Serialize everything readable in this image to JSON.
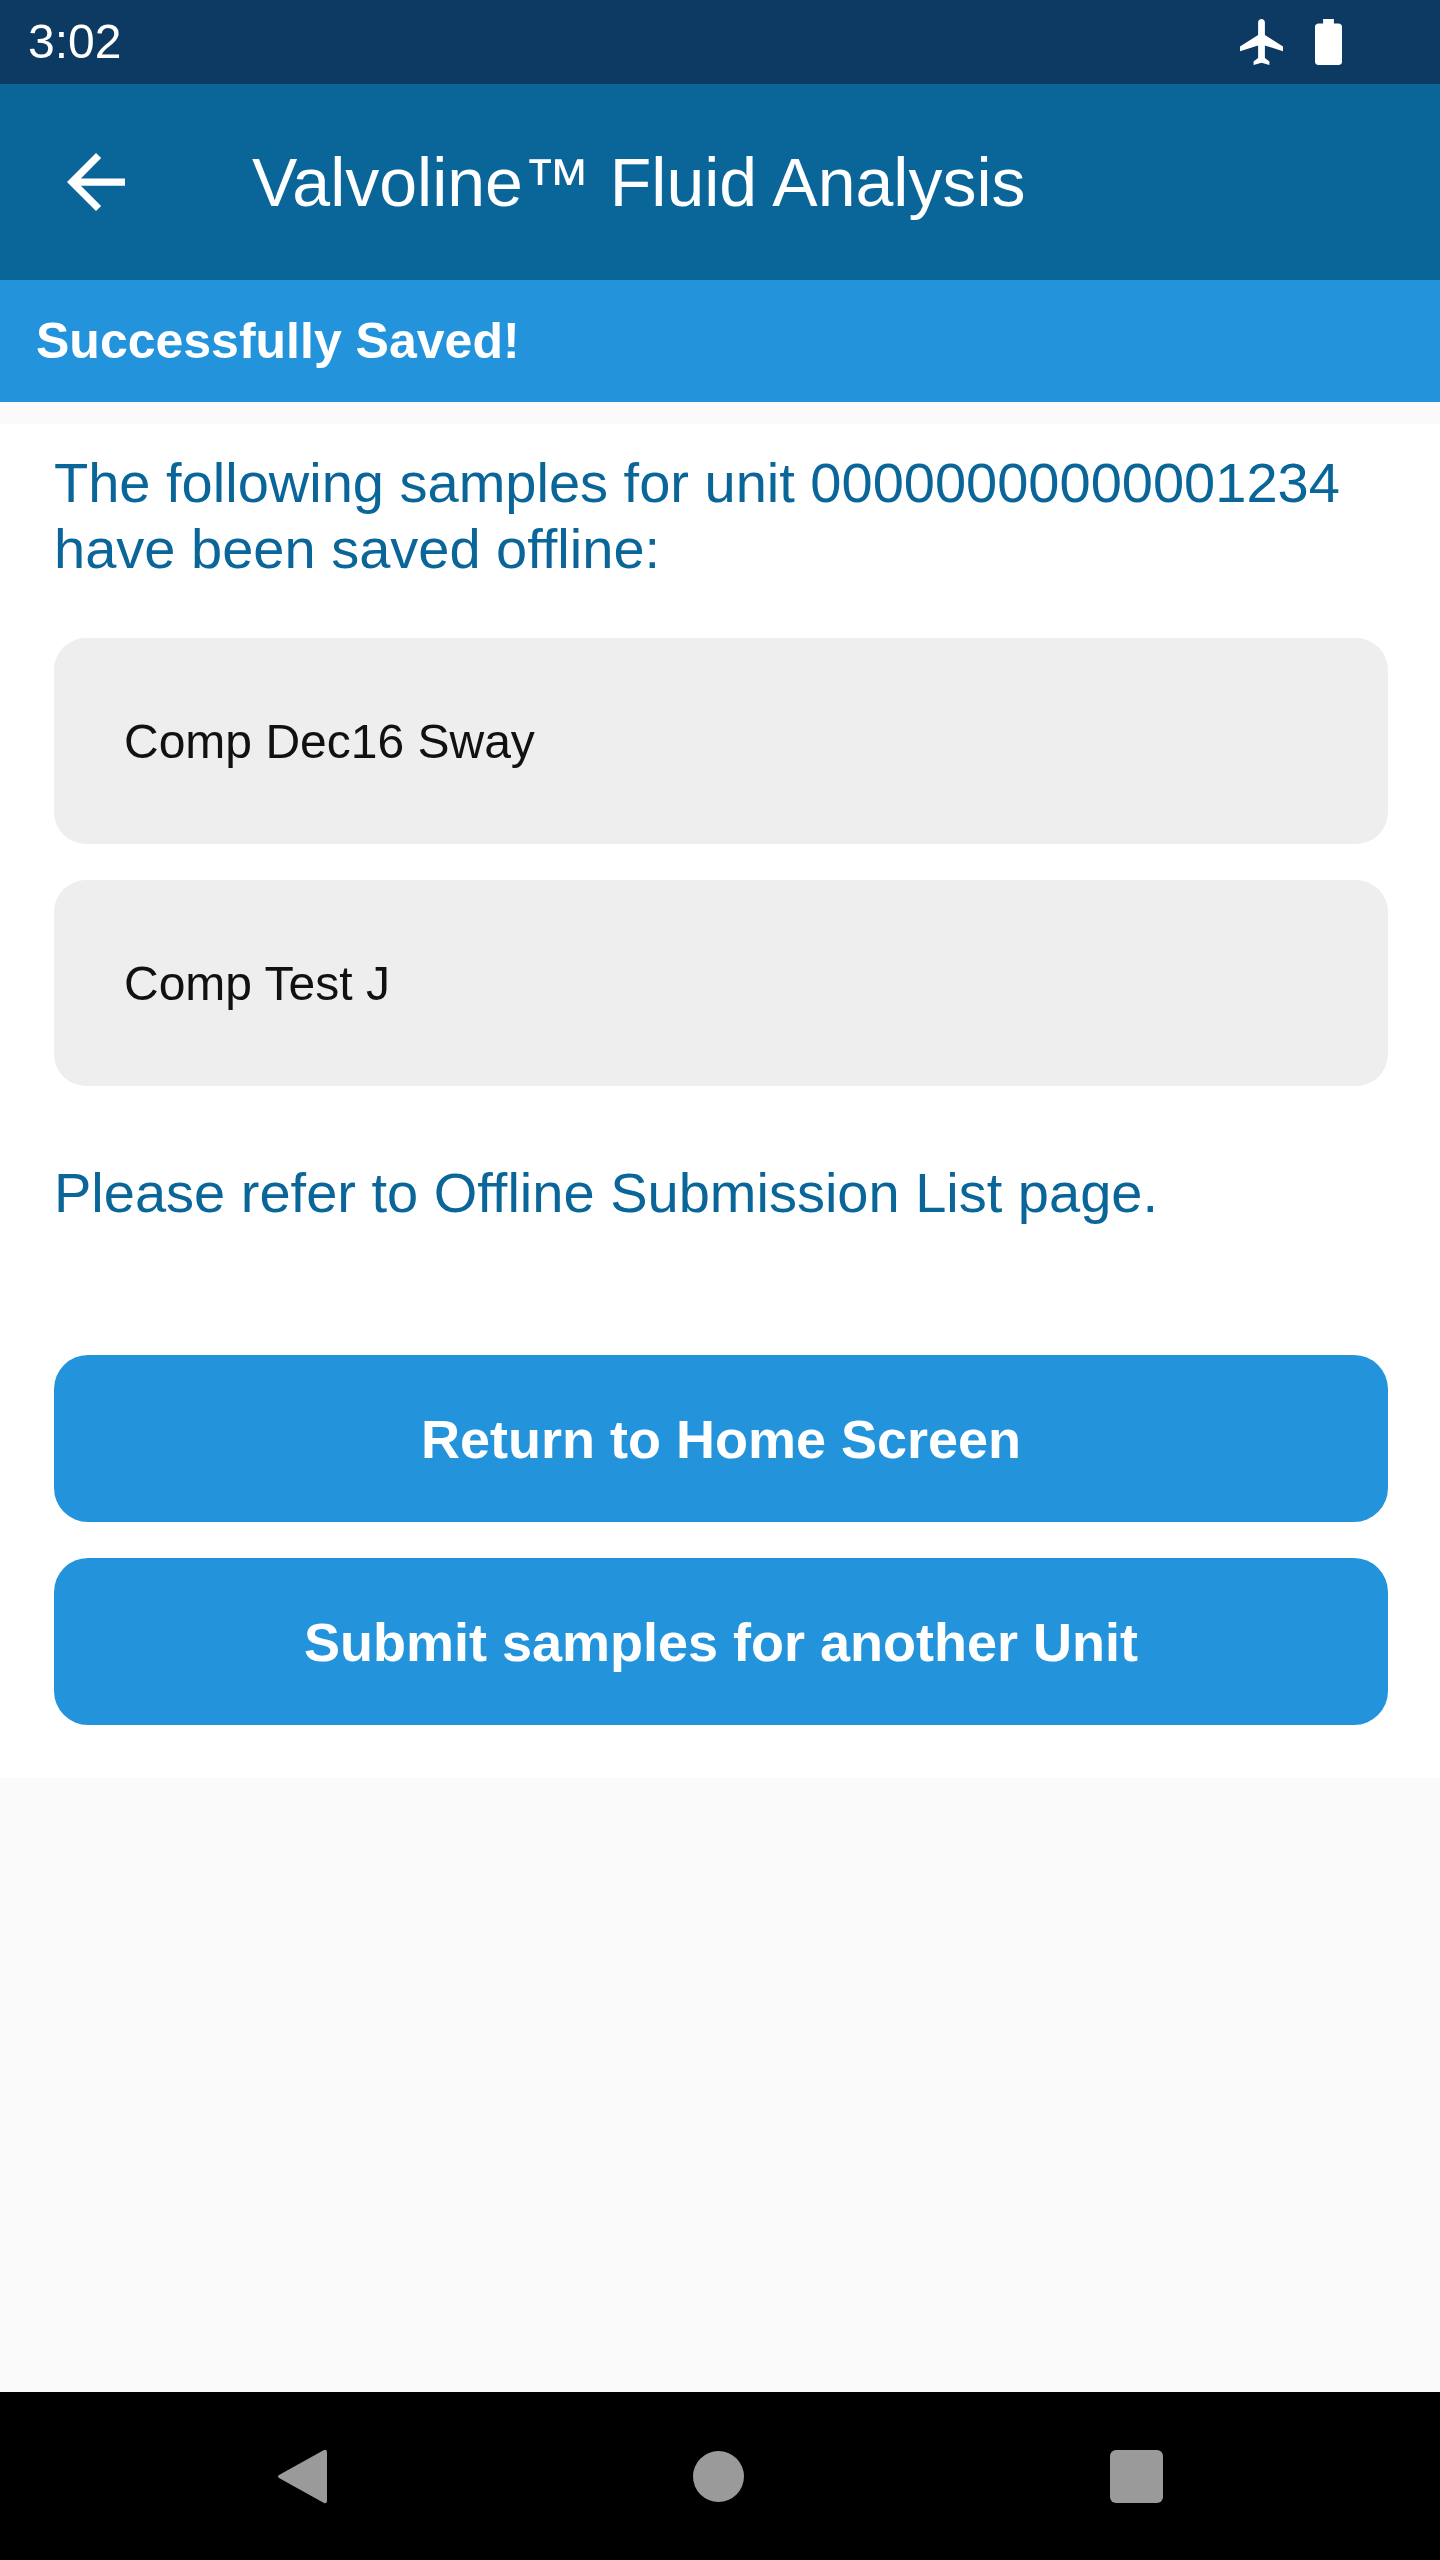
{
  "status_bar": {
    "time": "3:02"
  },
  "app_bar": {
    "title": "Valvoline™ Fluid Analysis"
  },
  "banner": {
    "message": "Successfully Saved!"
  },
  "content": {
    "intro": "The following samples for unit 00000000000001234 have been saved offline:",
    "samples": [
      "Comp Dec16 Sway",
      "Comp Test J"
    ],
    "note": "Please refer to Offline Submission List page.",
    "buttons": [
      "Return to Home Screen",
      "Submit samples for another Unit"
    ]
  }
}
